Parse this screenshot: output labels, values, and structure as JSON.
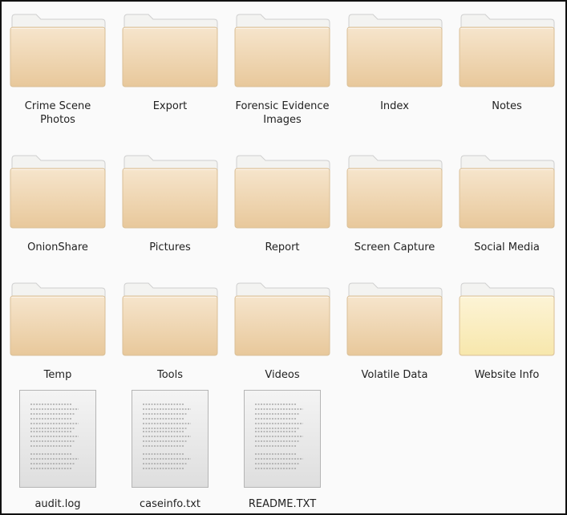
{
  "colors": {
    "folder_back": "#f3f3f1",
    "folder_front_top": "#f6e5cc",
    "folder_front_bottom": "#e8c89b",
    "folder_selected_top": "#fdf4d6",
    "folder_selected_bottom": "#f7e7ac",
    "file_paper": "#eeeeee"
  },
  "folders": [
    {
      "name": "Crime Scene Photos",
      "icon": "folder-icon"
    },
    {
      "name": "Export",
      "icon": "folder-icon"
    },
    {
      "name": "Forensic Evidence Images",
      "icon": "folder-icon"
    },
    {
      "name": "Index",
      "icon": "folder-icon"
    },
    {
      "name": "Notes",
      "icon": "folder-icon"
    },
    {
      "name": "OnionShare",
      "icon": "folder-icon"
    },
    {
      "name": "Pictures",
      "icon": "folder-icon"
    },
    {
      "name": "Report",
      "icon": "folder-icon"
    },
    {
      "name": "Screen Capture",
      "icon": "folder-icon"
    },
    {
      "name": "Social Media",
      "icon": "folder-icon"
    },
    {
      "name": "Temp",
      "icon": "folder-icon"
    },
    {
      "name": "Tools",
      "icon": "folder-icon"
    },
    {
      "name": "Videos",
      "icon": "folder-icon"
    },
    {
      "name": "Volatile Data",
      "icon": "folder-icon"
    },
    {
      "name": "Website Info",
      "icon": "folder-icon",
      "highlighted": true
    }
  ],
  "files": [
    {
      "name": "audit.log",
      "icon": "text-file-icon"
    },
    {
      "name": "caseinfo.txt",
      "icon": "text-file-icon"
    },
    {
      "name": "README.TXT",
      "icon": "text-file-icon"
    }
  ]
}
